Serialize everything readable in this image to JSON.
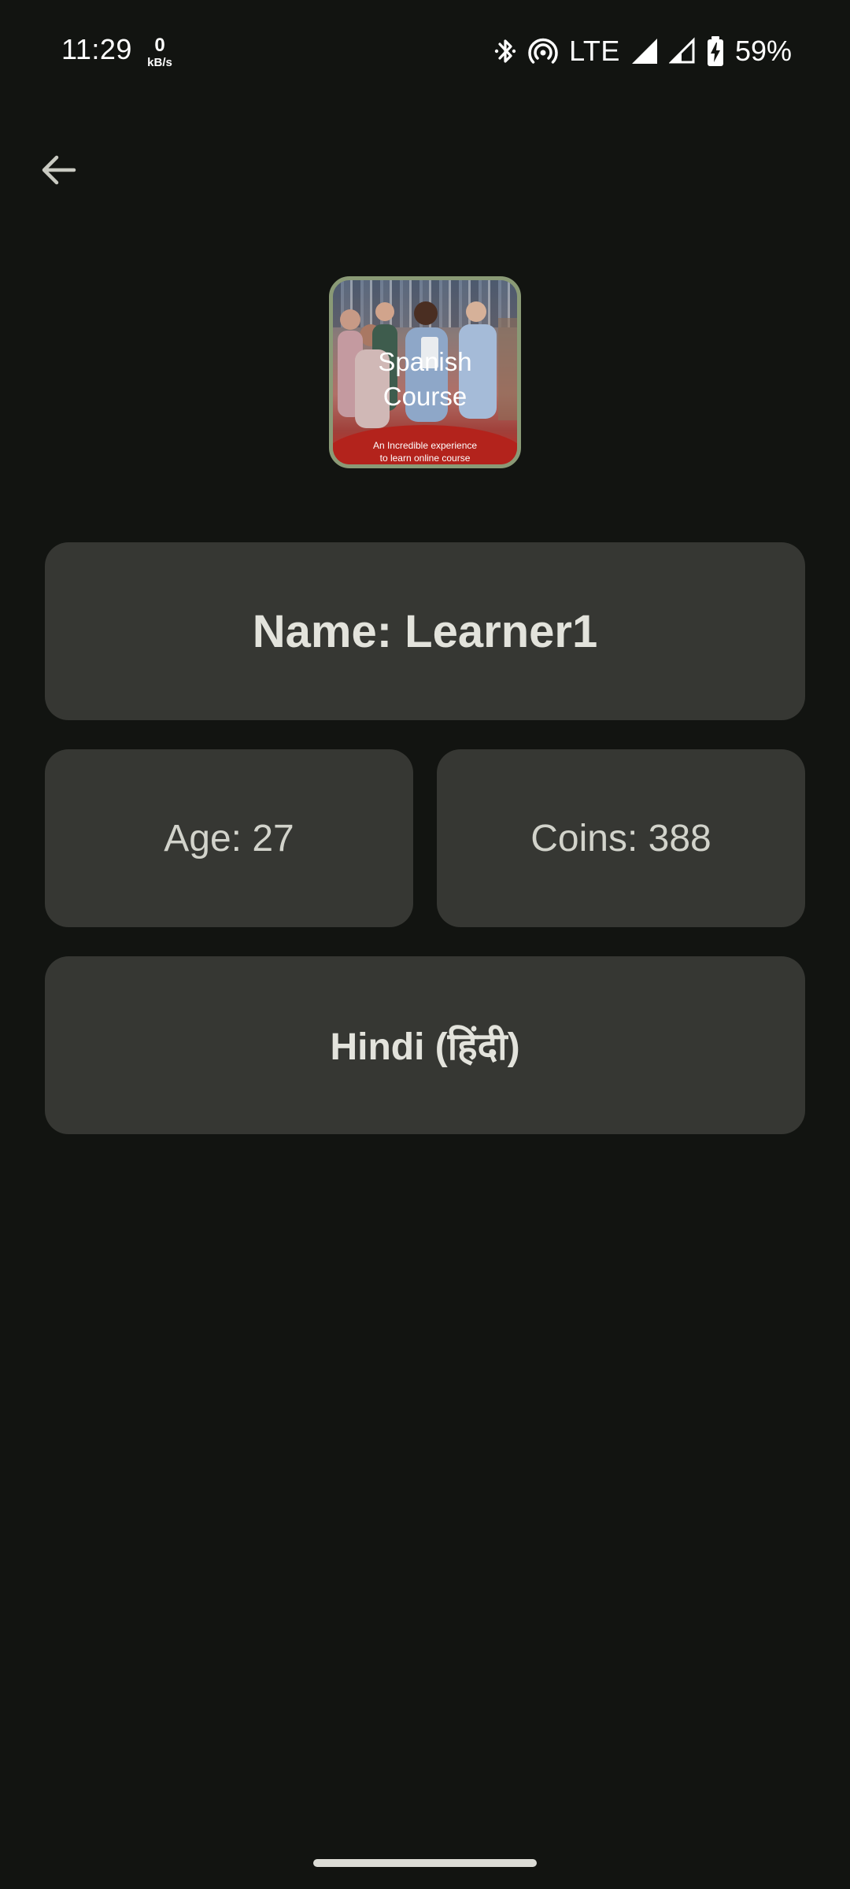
{
  "status_bar": {
    "time": "11:29",
    "net_speed_value": "0",
    "net_speed_unit": "kB/s",
    "network_type": "LTE",
    "battery_percent": "59%",
    "icons": [
      "bluetooth-icon",
      "hotspot-icon",
      "signal-full-icon",
      "signal-partial-icon",
      "battery-charging-icon"
    ]
  },
  "header": {
    "back_icon": "arrow-back-icon"
  },
  "course": {
    "title_line1": "Spanish",
    "title_line2": "Course",
    "tagline_line1": "An Incredible experience",
    "tagline_line2": "to learn online course"
  },
  "profile": {
    "name": "Name: Learner1",
    "age": "Age: 27",
    "coins": "Coins: 388",
    "language": "Hindi (हिंदी)"
  },
  "colors": {
    "background": "#121411",
    "card": "#363733",
    "text": "#e3e3dc",
    "thumb_border": "#8a9a76",
    "thumb_band": "#b3231c"
  }
}
